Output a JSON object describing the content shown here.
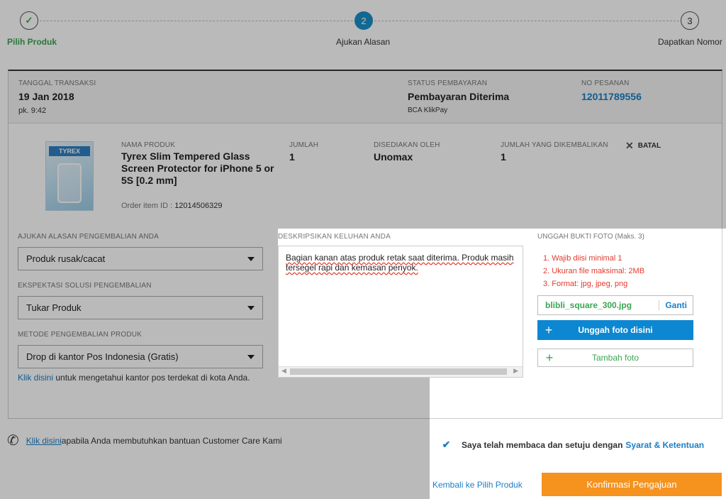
{
  "stepper": {
    "steps": [
      {
        "num": "✓",
        "label": "Pilih Produk"
      },
      {
        "num": "2",
        "label": "Ajukan Alasan"
      },
      {
        "num": "3",
        "label": "Dapatkan Nomor"
      }
    ]
  },
  "transaction": {
    "date_label": "TANGGAL TRANSAKSI",
    "date": "19 Jan 2018",
    "time": "pk. 9:42",
    "status_label": "STATUS PEMBAYARAN",
    "status": "Pembayaran Diterima",
    "method": "BCA KlikPay",
    "order_label": "NO PESANAN",
    "order_no": "12011789556"
  },
  "product": {
    "image_text": "TYREX",
    "name_label": "NAMA PRODUK",
    "name": "Tyrex Slim Tempered Glass Screen Protector for iPhone 5 or 5S [0.2 mm]",
    "order_item_label": "Order item ID :",
    "order_item_id": "12014506329",
    "qty_label": "JUMLAH",
    "qty": "1",
    "seller_label": "DISEDIAKAN OLEH",
    "seller": "Unomax",
    "return_qty_label": "JUMLAH YANG DIKEMBALIKAN",
    "return_qty": "1",
    "cancel_label": "BATAL"
  },
  "form": {
    "reason_label": "AJUKAN ALASAN PENGEMBALIAN ANDA",
    "reason_value": "Produk rusak/cacat",
    "solution_label": "EKSPEKTASI SOLUSI PENGEMBALIAN",
    "solution_value": "Tukar Produk",
    "method_label": "METODE PENGEMBALIAN PRODUK",
    "method_value": "Drop di kantor Pos Indonesia (Gratis)",
    "post_link": "Klik disini",
    "post_text": " untuk mengetahui kantor pos terdekat di kota Anda.",
    "desc_label": "DESKRIPSIKAN KELUHAN ANDA",
    "desc_value": "Bagian kanan atas produk retak saat diterima. Produk masih tersegel rapi dan kemasan penyok."
  },
  "upload": {
    "label": "UNGGAH BUKTI FOTO",
    "label_note": "(Maks. 3)",
    "rules": [
      "1. Wajib diisi minimal 1",
      "2. Ukuran file maksimal: 2MB",
      "3. Format: jpg, jpeg, png"
    ],
    "file_name": "blibli_square_300.jpg",
    "change_label": "Ganti",
    "upload_button": "Unggah foto disini",
    "add_button": "Tambah foto"
  },
  "footer": {
    "help_link": "Klik disini",
    "help_text": " apabila Anda membutuhkan bantuan Customer Care Kami",
    "agree_text": "Saya telah membaca dan setuju dengan ",
    "terms_link": "Syarat & Ketentuan",
    "back_link": "Kembali ke Pilih Produk",
    "confirm_button": "Konfirmasi Pengajuan"
  },
  "colors": {
    "accent_blue": "#1a7fc7",
    "step_green": "#3aa552",
    "rule_red": "#e23b2e",
    "confirm_orange": "#f6921e"
  }
}
